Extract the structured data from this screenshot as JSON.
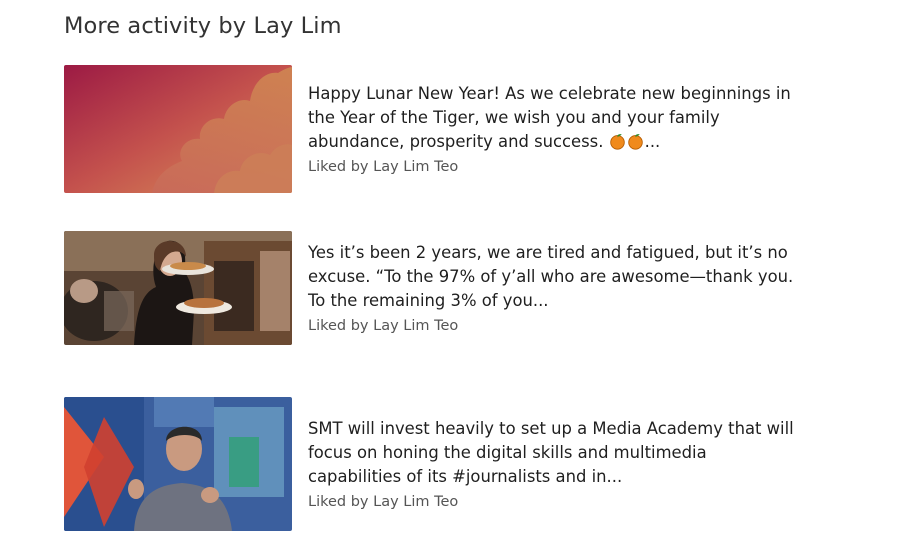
{
  "section": {
    "title": "More activity by Lay Lim"
  },
  "items": [
    {
      "text": "Happy Lunar New Year! As we celebrate new beginnings in the Year of the Tiger, we wish you and your family abundance, prosperity and success.",
      "text_suffix": "...",
      "emoji_icon": "tangerine-icon",
      "liked_by": "Liked by Lay Lim Teo",
      "thumbnail": "lunar-new-year-image"
    },
    {
      "text": "Yes it’s been 2 years, we are tired and fatigued, but it’s no excuse. “To the 97% of y’all who are awesome—thank you. To the remaining 3% of you...",
      "liked_by": "Liked by Lay Lim Teo",
      "thumbnail": "restaurant-server-image"
    },
    {
      "text": "SMT will invest heavily to set up a Media Academy that will focus on honing the digital skills and multimedia capabilities of its #journalists and in...",
      "liked_by": "Liked by Lay Lim Teo",
      "thumbnail": "speaker-photo-image"
    }
  ],
  "colors": {
    "title": "#333333",
    "text": "#1f1f1f",
    "meta": "#555555",
    "tangerine": "#f08a1c"
  }
}
